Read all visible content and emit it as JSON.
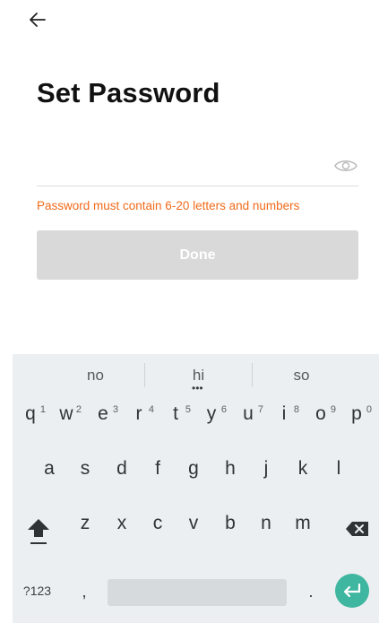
{
  "header": {
    "back_icon": "arrow-left-icon",
    "title": "Set Password"
  },
  "form": {
    "password_value": "",
    "password_placeholder": "",
    "eye_icon": "eye-icon",
    "hint": "Password must contain 6-20 letters and numbers",
    "hint_color": "#f26a19",
    "done_label": "Done",
    "done_disabled": true
  },
  "keyboard": {
    "suggestions": [
      "no",
      "hi",
      "so"
    ],
    "row1": [
      {
        "key": "q",
        "hint": "1"
      },
      {
        "key": "w",
        "hint": "2"
      },
      {
        "key": "e",
        "hint": "3"
      },
      {
        "key": "r",
        "hint": "4"
      },
      {
        "key": "t",
        "hint": "5"
      },
      {
        "key": "y",
        "hint": "6"
      },
      {
        "key": "u",
        "hint": "7"
      },
      {
        "key": "i",
        "hint": "8"
      },
      {
        "key": "o",
        "hint": "9"
      },
      {
        "key": "p",
        "hint": "0"
      }
    ],
    "row2": [
      "a",
      "s",
      "d",
      "f",
      "g",
      "h",
      "j",
      "k",
      "l"
    ],
    "row3": [
      "z",
      "x",
      "c",
      "v",
      "b",
      "n",
      "m"
    ],
    "shift_icon": "shift-icon",
    "backspace_icon": "backspace-icon",
    "symbols_label": "?123",
    "comma_label": ",",
    "period_label": ".",
    "enter_icon": "enter-icon",
    "accent_color": "#3fb6a0"
  }
}
